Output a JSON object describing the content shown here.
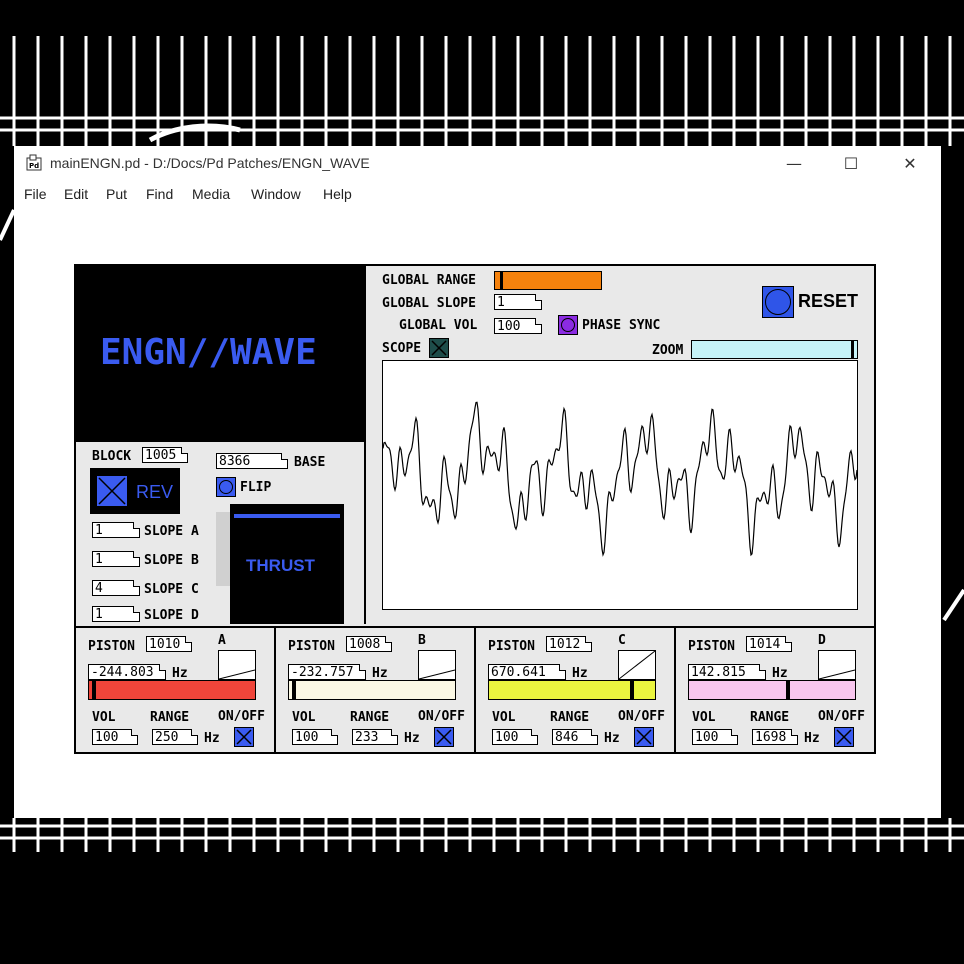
{
  "window": {
    "title": "mainENGN.pd  - D:/Docs/Pd Patches/ENGN_WAVE",
    "app_icon": "pd-icon",
    "controls": {
      "minimize": "—",
      "maximize": "☐",
      "close": "✕"
    }
  },
  "menu": [
    "File",
    "Edit",
    "Put",
    "Find",
    "Media",
    "Window",
    "Help"
  ],
  "patch": {
    "logo": "ENGN//WAVE",
    "global_range": {
      "label": "GLOBAL RANGE",
      "level": 0.05,
      "color": "#f5820d"
    },
    "global_slope": {
      "label": "GLOBAL SLOPE",
      "value": "1"
    },
    "global_vol": {
      "label": "GLOBAL VOL",
      "value": "100"
    },
    "phase_sync": {
      "label": "PHASE SYNC",
      "color": "#8b2be2"
    },
    "scope": {
      "label": "SCOPE"
    },
    "zoom": {
      "label": "ZOOM",
      "level": 0.98,
      "color": "#c6f3f7"
    },
    "reset": {
      "label": "RESET",
      "color": "#2f55e8"
    },
    "block": {
      "label": "BLOCK",
      "value": "1005"
    },
    "base": {
      "label": "BASE",
      "value": "8366"
    },
    "flip": {
      "label": "FLIP"
    },
    "rev": {
      "label": "REV"
    },
    "slopes": [
      {
        "label": "SLOPE A",
        "value": "1"
      },
      {
        "label": "SLOPE B",
        "value": "1"
      },
      {
        "label": "SLOPE C",
        "value": "4"
      },
      {
        "label": "SLOPE D",
        "value": "1"
      }
    ],
    "thrust": {
      "label": "THRUST"
    },
    "pistons": [
      {
        "id": "A",
        "label": "PISTON",
        "value": "1010",
        "hz": "-244.803",
        "hz_unit": "Hz",
        "slider_color": "#f0453a",
        "level": 0.02,
        "vol_label": "VOL",
        "vol": "100",
        "range_label": "RANGE",
        "range": "250",
        "range_unit": "Hz",
        "onoff_label": "ON/OFF"
      },
      {
        "id": "B",
        "label": "PISTON",
        "value": "1008",
        "hz": "-232.757",
        "hz_unit": "Hz",
        "slider_color": "#fbf8e4",
        "level": 0.02,
        "vol_label": "VOL",
        "vol": "100",
        "range_label": "RANGE",
        "range": "233",
        "range_unit": "Hz",
        "onoff_label": "ON/OFF"
      },
      {
        "id": "C",
        "label": "PISTON",
        "value": "1012",
        "hz": "670.641",
        "hz_unit": "Hz",
        "slider_color": "#eaf53f",
        "level": 0.87,
        "vol_label": "VOL",
        "vol": "100",
        "range_label": "RANGE",
        "range": "846",
        "range_unit": "Hz",
        "onoff_label": "ON/OFF"
      },
      {
        "id": "D",
        "label": "PISTON",
        "value": "1014",
        "hz": "142.815",
        "hz_unit": "Hz",
        "slider_color": "#f8c6ee",
        "level": 0.6,
        "vol_label": "VOL",
        "vol": "100",
        "range_label": "RANGE",
        "range": "1698",
        "range_unit": "Hz",
        "onoff_label": "ON/OFF"
      }
    ]
  }
}
